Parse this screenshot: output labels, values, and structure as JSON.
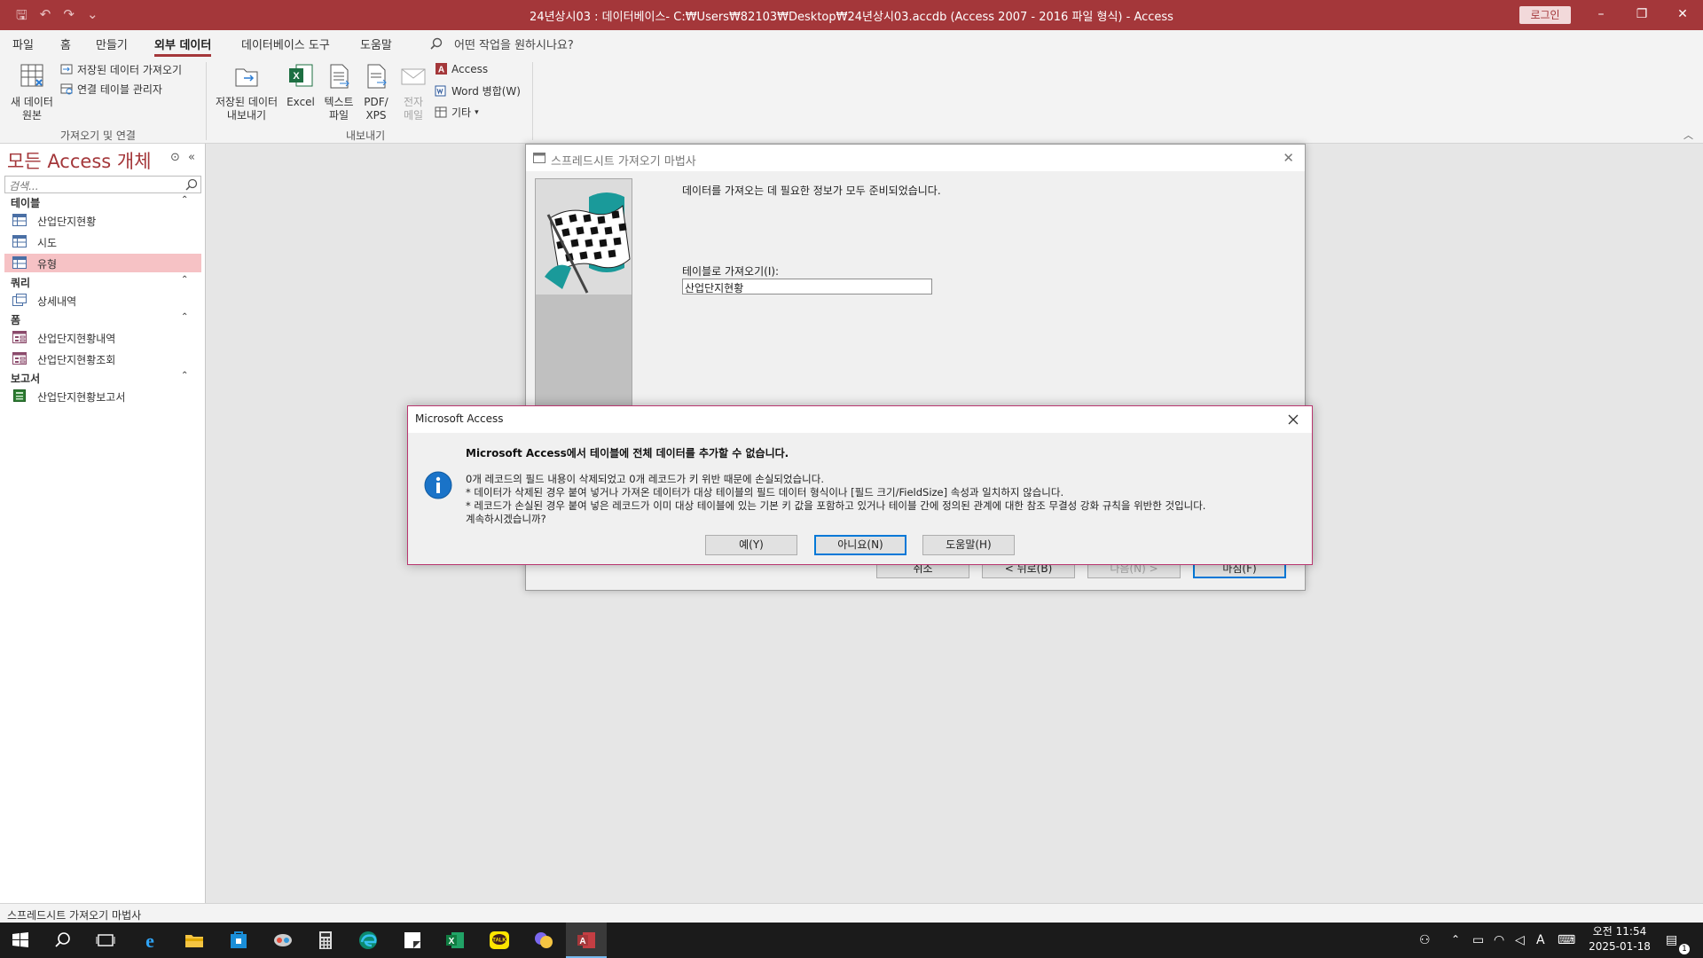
{
  "app": {
    "title": "24년상시03 : 데이터베이스- C:₩Users₩82103₩Desktop₩24년상시03.accdb (Access 2007 - 2016 파일 형식) - Access",
    "login_label": "로그인"
  },
  "ribbon_tabs": [
    "파일",
    "홈",
    "만들기",
    "외부 데이터",
    "데이터베이스 도구",
    "도움말"
  ],
  "tell_me": "어떤 작업을 원하시나요?",
  "ribbon": {
    "import_group": {
      "new_source_label": "새 데이터\n원본",
      "saved_imports": "저장된 데이터 가져오기",
      "linked_table_manager": "연결 테이블 관리자",
      "label": "가져오기 및 연결"
    },
    "export_group": {
      "saved_exports": "저장된 데이터\n내보내기",
      "excel": "Excel",
      "text_file": "텍스트\n파일",
      "pdf_xps": "PDF/\nXPS",
      "email": "전자\n메일",
      "access": "Access",
      "word_merge": "Word 병합(W)",
      "more": "기타",
      "label": "내보내기"
    }
  },
  "nav": {
    "title": "모든 Access 개체",
    "search_placeholder": "검색...",
    "categories": [
      {
        "name": "테이블",
        "items": [
          "산업단지현황",
          "시도",
          "유형"
        ]
      },
      {
        "name": "쿼리",
        "items": [
          "상세내역"
        ]
      },
      {
        "name": "폼",
        "items": [
          "산업단지현황내역",
          "산업단지현황조회"
        ]
      },
      {
        "name": "보고서",
        "items": [
          "산업단지현황보고서"
        ]
      }
    ],
    "selected_item": "유형"
  },
  "wizard": {
    "title": "스프레드시트 가져오기 마법사",
    "message": "데이터를 가져오는 데 필요한 정보가 모두 준비되었습니다.",
    "import_to_label": "테이블로 가져오기(I):",
    "import_to_value": "산업단지현황",
    "buttons": [
      "취소",
      "< 뒤로(B)",
      "다음(N) >",
      "마침(F)"
    ]
  },
  "message_box": {
    "title": "Microsoft Access",
    "heading": "Microsoft Access에서 테이블에 전체 데이터를 추가할 수 없습니다.",
    "lines": [
      "0개 레코드의 필드 내용이 삭제되었고 0개 레코드가 키 위반 때문에 손실되었습니다.",
      "* 데이터가 삭제된 경우 붙여 넣거나 가져온 데이터가 대상 테이블의 필드 데이터 형식이나 [필드 크기/FieldSize] 속성과 일치하지 않습니다.",
      "* 레코드가 손실된 경우 붙여 넣은 레코드가 이미 대상 테이블에 있는 기본 키 값을 포함하고 있거나 테이블 간에 정의된 관계에 대한 참조 무결성 강화 규칙을 위반한 것입니다.",
      "계속하시겠습니까?"
    ],
    "buttons": [
      "예(Y)",
      "아니요(N)",
      "도움말(H)"
    ]
  },
  "status_bar": "스프레드시트 가져오기 마법사",
  "taskbar": {
    "time": "오전 11:54",
    "date": "2025-01-18",
    "ime": "A",
    "notifications": "1"
  },
  "colors": {
    "access_red": "#a4373a",
    "selected_item": "#f6c2c5",
    "default_button_border": "#0078d7"
  }
}
